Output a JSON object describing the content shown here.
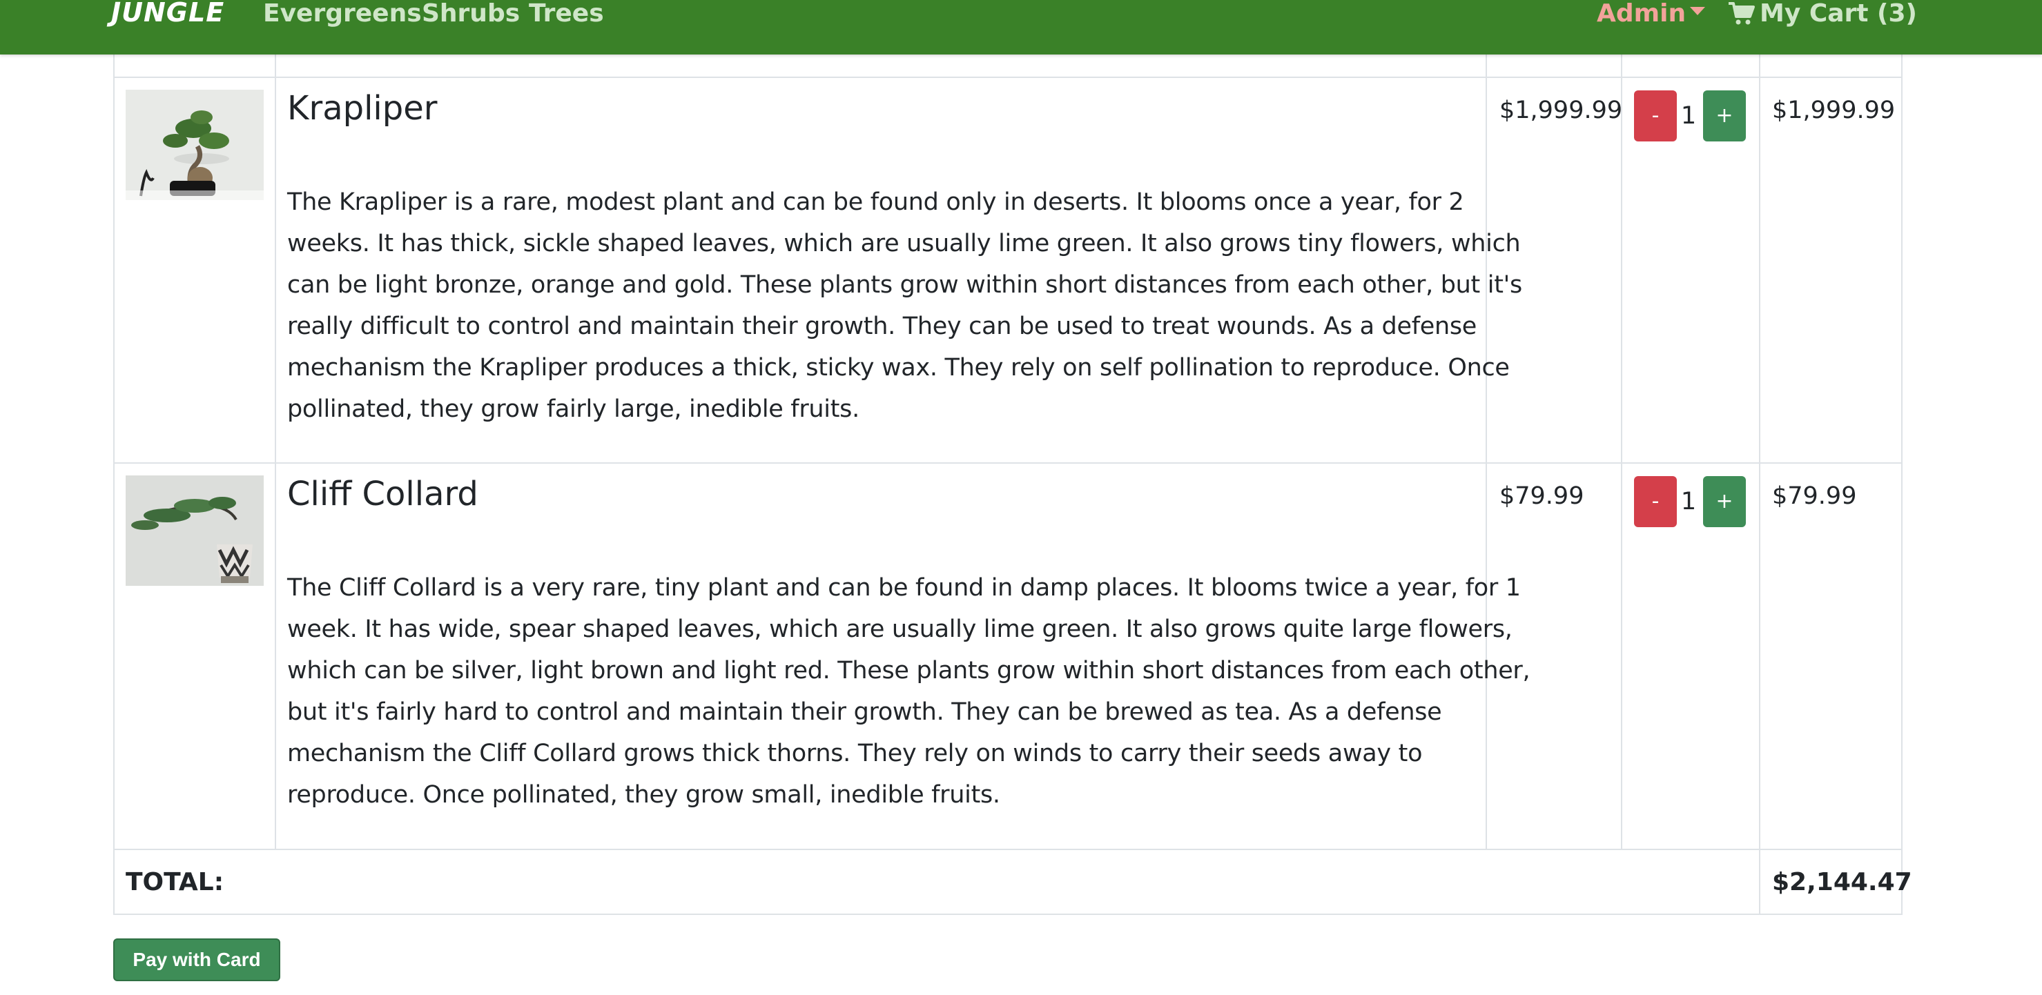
{
  "navbar": {
    "brand": "JUNGLE",
    "links": [
      "Evergreens",
      "Shrubs",
      "Trees"
    ],
    "admin_label": "Admin",
    "cart_label": "My Cart (3)",
    "bg_color": "#3a8128"
  },
  "cart": {
    "items": [
      {
        "name": "Krapliper",
        "description_lines": [
          "The Krapliper is a rare, modest plant and can be found only in deserts. It blooms once a year, for 2",
          "weeks. It has thick, sickle shaped leaves, which are usually lime green. It also grows tiny flowers, which",
          "can be light bronze, orange and gold. These plants grow within short distances from each other, but it's",
          "really difficult to control and maintain their growth. They can be used to treat wounds. As a defense",
          "mechanism the Krapliper produces a thick, sticky wax. They rely on self pollination to reproduce. Once",
          "pollinated, they grow fairly large, inedible fruits."
        ],
        "price": "$1,999.99",
        "quantity": "1",
        "subtotal": "$1,999.99",
        "minus_label": "-",
        "plus_label": "+"
      },
      {
        "name": "Cliff Collard",
        "description_lines": [
          "The Cliff Collard is a very rare, tiny plant and can be found in damp places. It blooms twice a year, for 1",
          "week. It has wide, spear shaped leaves, which are usually lime green. It also grows quite large flowers,",
          "which can be silver, light brown and light red. These plants grow within short distances from each other,",
          "but it's fairly hard to control and maintain their growth. They can be brewed as tea. As a defense",
          "mechanism the Cliff Collard grows thick thorns. They rely on winds to carry their seeds away to",
          "reproduce. Once pollinated, they grow small, inedible fruits."
        ],
        "price": "$79.99",
        "quantity": "1",
        "subtotal": "$79.99",
        "minus_label": "-",
        "plus_label": "+"
      }
    ],
    "total_label": "TOTAL:",
    "total_value": "$2,144.47",
    "pay_button_label": "Pay with Card"
  },
  "colors": {
    "minus_button": "#d43f4a",
    "plus_button": "#3e8d57",
    "admin_text": "#f2a39a"
  }
}
